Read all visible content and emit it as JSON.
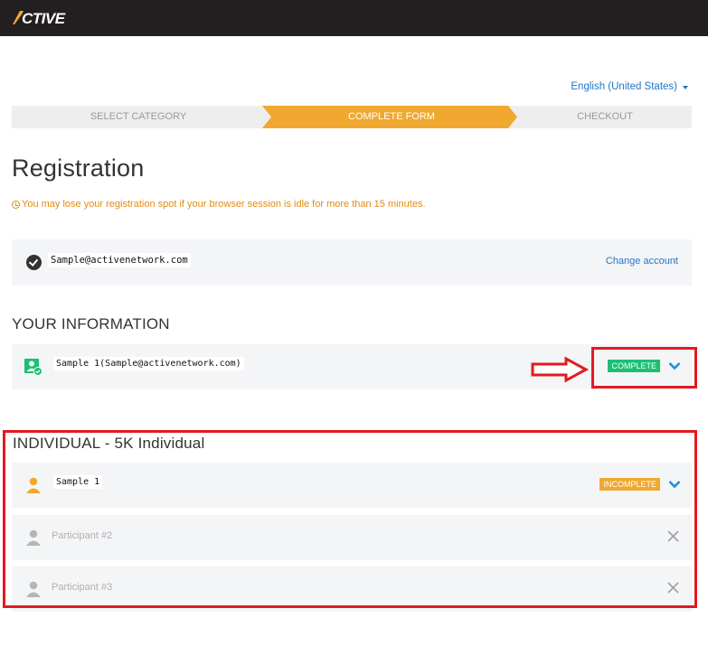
{
  "header": {
    "logo_text": "ACTIVE",
    "bg_color": "#231f20",
    "accent_color": "#f0a830"
  },
  "language": {
    "label": "English (United States)"
  },
  "steps": [
    {
      "label": "SELECT CATEGORY",
      "state": "done"
    },
    {
      "label": "COMPLETE FORM",
      "state": "active"
    },
    {
      "label": "CHECKOUT",
      "state": "pending"
    }
  ],
  "page": {
    "title": "Registration",
    "warning": "You may lose your registration spot if your browser session is idle for more than 15 minutes."
  },
  "account": {
    "email": "Sample@activenetwork.com",
    "change_label": "Change account"
  },
  "your_information": {
    "heading": "YOUR INFORMATION",
    "entry": {
      "name": "Sample 1(Sample@activenetwork.com)",
      "status": "COMPLETE",
      "status_color": "#1dbf73"
    }
  },
  "individual": {
    "heading": "INDIVIDUAL - 5K Individual",
    "participants": [
      {
        "name": "Sample 1",
        "status": "INCOMPLETE",
        "status_color": "#f0a830"
      },
      {
        "name": "Participant #2",
        "status": ""
      },
      {
        "name": "Participant #3",
        "status": ""
      }
    ]
  },
  "icons": {
    "check": "check-circle-icon",
    "user_complete": "user-check-icon",
    "user_incomplete": "user-icon",
    "expand": "chevron-down-icon",
    "remove": "close-icon",
    "warning": "clock-icon",
    "caret": "caret-down-icon"
  },
  "annotation_color": "#e11b22"
}
